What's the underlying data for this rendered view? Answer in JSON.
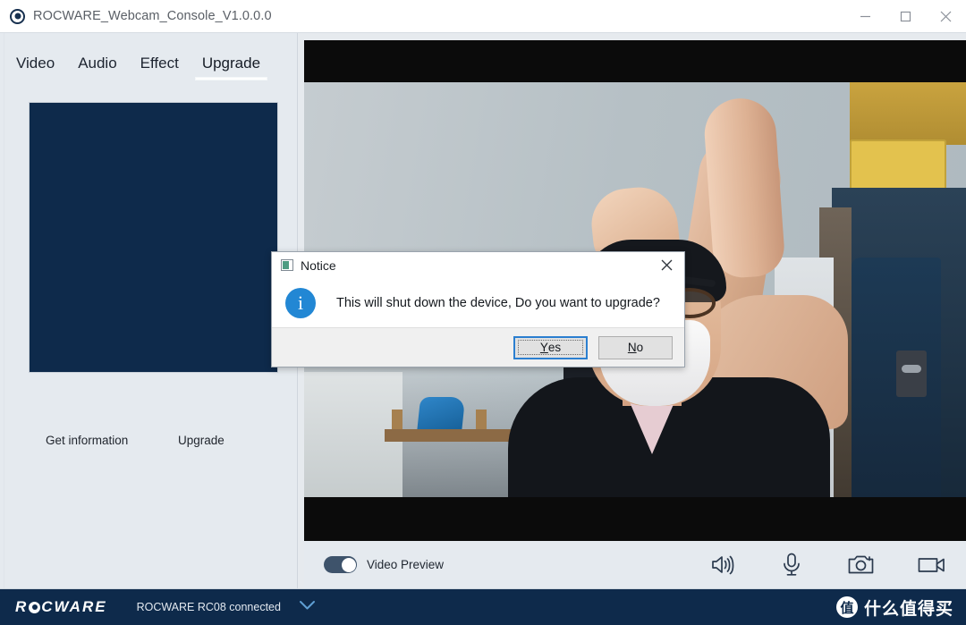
{
  "window": {
    "title": "ROCWARE_Webcam_Console_V1.0.0.0",
    "icon": "app-circle-icon",
    "controls": {
      "minimize": "minimize-icon",
      "maximize": "maximize-icon",
      "close": "close-icon"
    }
  },
  "sidebar": {
    "tabs": [
      {
        "label": "Video",
        "active": false
      },
      {
        "label": "Audio",
        "active": false
      },
      {
        "label": "Effect",
        "active": false
      },
      {
        "label": "Upgrade",
        "active": true
      }
    ],
    "info_panel": {
      "content": "",
      "background": "#0e2a4b"
    },
    "actions": [
      {
        "label": "Get information"
      },
      {
        "label": "Upgrade"
      }
    ]
  },
  "video": {
    "letterbox_color": "#0b0b0b",
    "preview_active": true
  },
  "toolbar": {
    "toggle": {
      "label": "Video Preview",
      "state": "on",
      "color": "#3e536b"
    },
    "icons": [
      {
        "name": "speaker-icon"
      },
      {
        "name": "microphone-icon"
      },
      {
        "name": "camera-icon"
      },
      {
        "name": "video-camera-icon"
      }
    ]
  },
  "statusbar": {
    "brand_left": "R",
    "brand_right": "CWARE",
    "device_status": "ROCWARE RC08 connected",
    "chevron": "chevron-down-icon",
    "background": "#0e2a4b"
  },
  "watermark": {
    "badge": "值",
    "text": "什么值得买"
  },
  "dialog": {
    "title": "Notice",
    "icon": "notice-window-icon",
    "close": "close-icon",
    "info_icon": "i",
    "message": "This will shut down the device, Do you want to upgrade?",
    "buttons": [
      {
        "label_before": "",
        "mnemonic": "Y",
        "label_after": "es",
        "default": true
      },
      {
        "label_before": "",
        "mnemonic": "N",
        "label_after": "o",
        "default": false
      }
    ],
    "accent": "#2b7fd0"
  }
}
